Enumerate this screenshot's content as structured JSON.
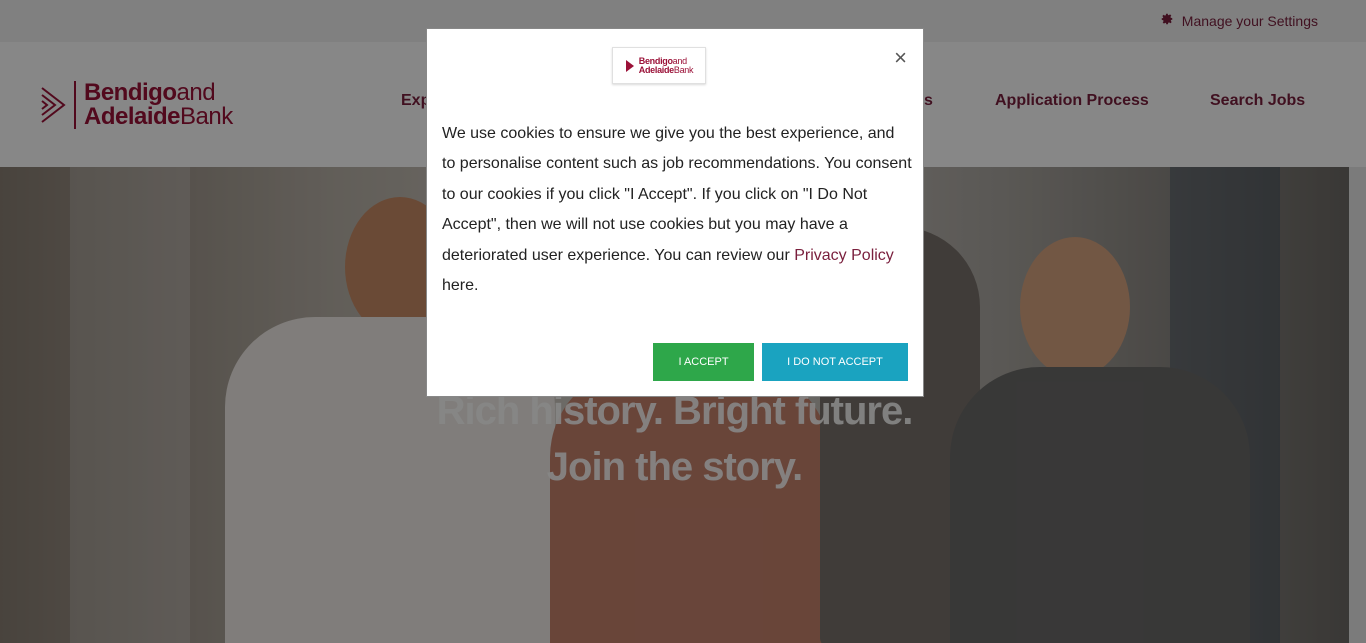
{
  "utility_bar": {
    "settings_label": "Manage your Settings",
    "settings_icon": "gear-icon"
  },
  "header": {
    "logo": {
      "line1_bold": "Bendigo",
      "line1_light": "and",
      "line2_bold": "Adelaide",
      "line2_light": "Bank"
    },
    "nav": [
      {
        "label": "Exp"
      },
      {
        "label": "s"
      },
      {
        "label": "Application Process"
      },
      {
        "label": "Search Jobs"
      }
    ]
  },
  "hero": {
    "line1": "Rich history. Bright future.",
    "line2": "Join the story."
  },
  "cookie_modal": {
    "logo": {
      "line1_bold": "Bendigo",
      "line1_light": "and",
      "line2_bold": "Adelaide",
      "line2_light": "Bank"
    },
    "close_symbol": "×",
    "message_before_link": "We use cookies to ensure we give you the best experience, and to personalise content such as job recommendations. You consent to our cookies if you click \"I Accept\". If you click on \"I Do Not Accept\", then we will not use cookies but you may have a deteriorated user experience. You can review our ",
    "link_text": "Privacy Policy",
    "message_after_link": " here.",
    "accept_label": "I ACCEPT",
    "decline_label": "I DO NOT ACCEPT"
  },
  "colors": {
    "brand": "#9b1138",
    "nav_text": "#7a1f3d",
    "accept_button": "#2ea74a",
    "decline_button": "#1aa3c0"
  }
}
